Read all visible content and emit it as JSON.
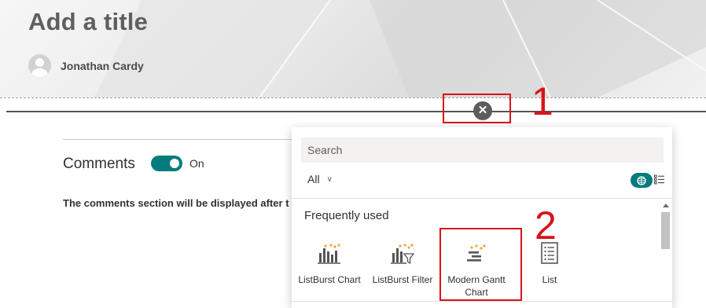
{
  "header": {
    "title": "Add a title",
    "author": "Jonathan Cardy"
  },
  "section_toolbar": {
    "close_glyph": "✕",
    "close_icon": "close-icon"
  },
  "annotations": {
    "step1": "1",
    "step2": "2",
    "color": "#d7141a"
  },
  "comments": {
    "label": "Comments",
    "toggle_state": "On",
    "toggle_on": true,
    "note": "The comments section will be displayed after t"
  },
  "toolbox": {
    "search_placeholder": "Search",
    "filter_value": "All",
    "view_mode": "grid",
    "section_heading": "Frequently used",
    "tiles": [
      {
        "label": "ListBurst Chart",
        "icon": "bar-chart-icon"
      },
      {
        "label": "ListBurst Filter",
        "icon": "chart-filter-icon"
      },
      {
        "label": "Modern Gantt Chart",
        "icon": "gantt-chart-icon"
      },
      {
        "label": "List",
        "icon": "list-icon"
      }
    ]
  },
  "colors": {
    "accent": "#037c7d",
    "icon_orange": "#f2a33a",
    "icon_gray": "#555555"
  }
}
